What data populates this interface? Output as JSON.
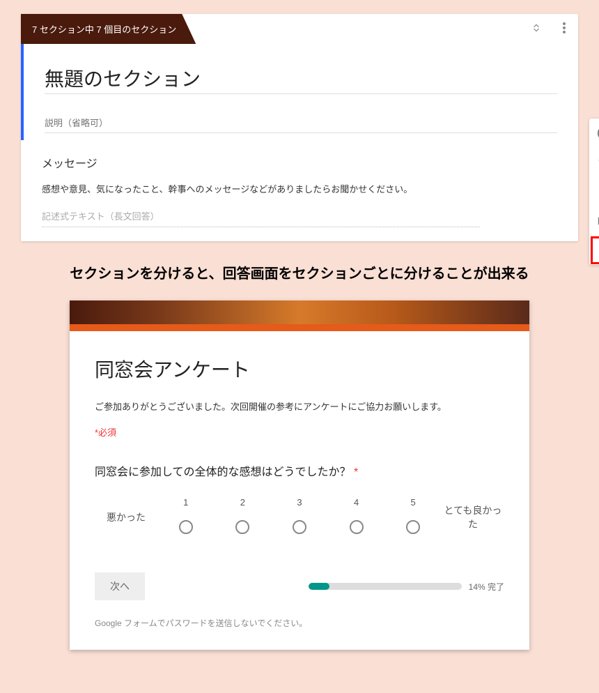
{
  "editor": {
    "section_indicator": "7 セクション中 7 個目のセクション",
    "section_title": "無題のセクション",
    "section_desc_placeholder": "説明（省略可）",
    "question_title": "メッセージ",
    "question_desc": "感想や意見、気になったこと、幹事へのメッセージなどがありましたらお聞かせください。",
    "answer_placeholder": "記述式テキスト（長文回答）"
  },
  "toolbar": {
    "add": "add-question-icon",
    "text": "add-title-icon",
    "image": "add-image-icon",
    "video": "add-video-icon",
    "section": "add-section-icon"
  },
  "caption": "セクションを分けると、回答画面をセクションごとに分けることが出来る",
  "preview": {
    "form_title": "同窓会アンケート",
    "form_desc": "ご参加ありがとうございました。次回開催の参考にアンケートにご協力お願いします。",
    "required_note": "*必須",
    "question": "同窓会に参加しての全体的な感想はどうでしたか？ ",
    "asterisk": "*",
    "scale_left": "悪かった",
    "scale_right": "とても良かった",
    "scale_options": [
      "1",
      "2",
      "3",
      "4",
      "5"
    ],
    "next_button": "次へ",
    "progress_percent": 14,
    "progress_text": "14% 完了",
    "footer": "Google フォームでパスワードを送信しないでください。"
  }
}
